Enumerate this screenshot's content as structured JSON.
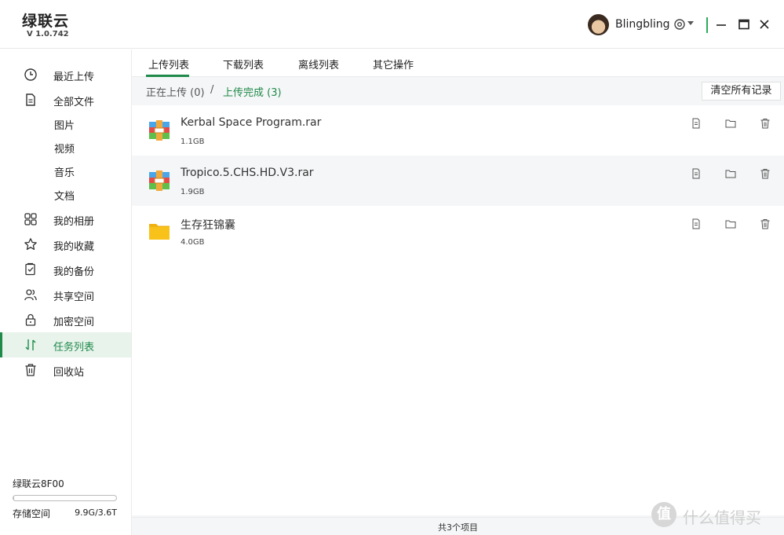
{
  "app": {
    "name": "绿联云",
    "version": "V 1.0.742"
  },
  "user": {
    "name": "Blingbling"
  },
  "sidebar": {
    "items": [
      {
        "label": "最近上传",
        "icon": "clock-icon"
      },
      {
        "label": "全部文件",
        "icon": "file-icon"
      },
      {
        "label": "图片"
      },
      {
        "label": "视频"
      },
      {
        "label": "音乐"
      },
      {
        "label": "文档"
      },
      {
        "label": "我的相册",
        "icon": "grid-icon"
      },
      {
        "label": "我的收藏",
        "icon": "star-icon"
      },
      {
        "label": "我的备份",
        "icon": "backup-icon"
      },
      {
        "label": "共享空间",
        "icon": "users-icon"
      },
      {
        "label": "加密空间",
        "icon": "lock-icon"
      },
      {
        "label": "任务列表",
        "icon": "transfer-icon",
        "active": true
      },
      {
        "label": "回收站",
        "icon": "trash-icon"
      }
    ],
    "device": "绿联云8F00",
    "storage_label": "存储空间",
    "storage_value": "9.9G/3.6T",
    "storage_fraction": 0.0027
  },
  "tabs": [
    "上传列表",
    "下载列表",
    "离线列表",
    "其它操作"
  ],
  "subbar": {
    "uploading": "正在上传 (0)",
    "separator": "/",
    "done": "上传完成 (3)",
    "clear_label": "清空所有记录"
  },
  "files": [
    {
      "name": "Kerbal Space Program.rar",
      "size": "1.1GB",
      "type": "archive"
    },
    {
      "name": "Tropico.5.CHS.HD.V3.rar",
      "size": "1.9GB",
      "type": "archive"
    },
    {
      "name": "生存狂锦囊",
      "size": "4.0GB",
      "type": "folder"
    }
  ],
  "footer": "共3个项目",
  "watermark": {
    "symbol": "值",
    "text": "什么值得买"
  },
  "colors": {
    "accent": "#1f8a49",
    "folder": "#f8c21a"
  }
}
